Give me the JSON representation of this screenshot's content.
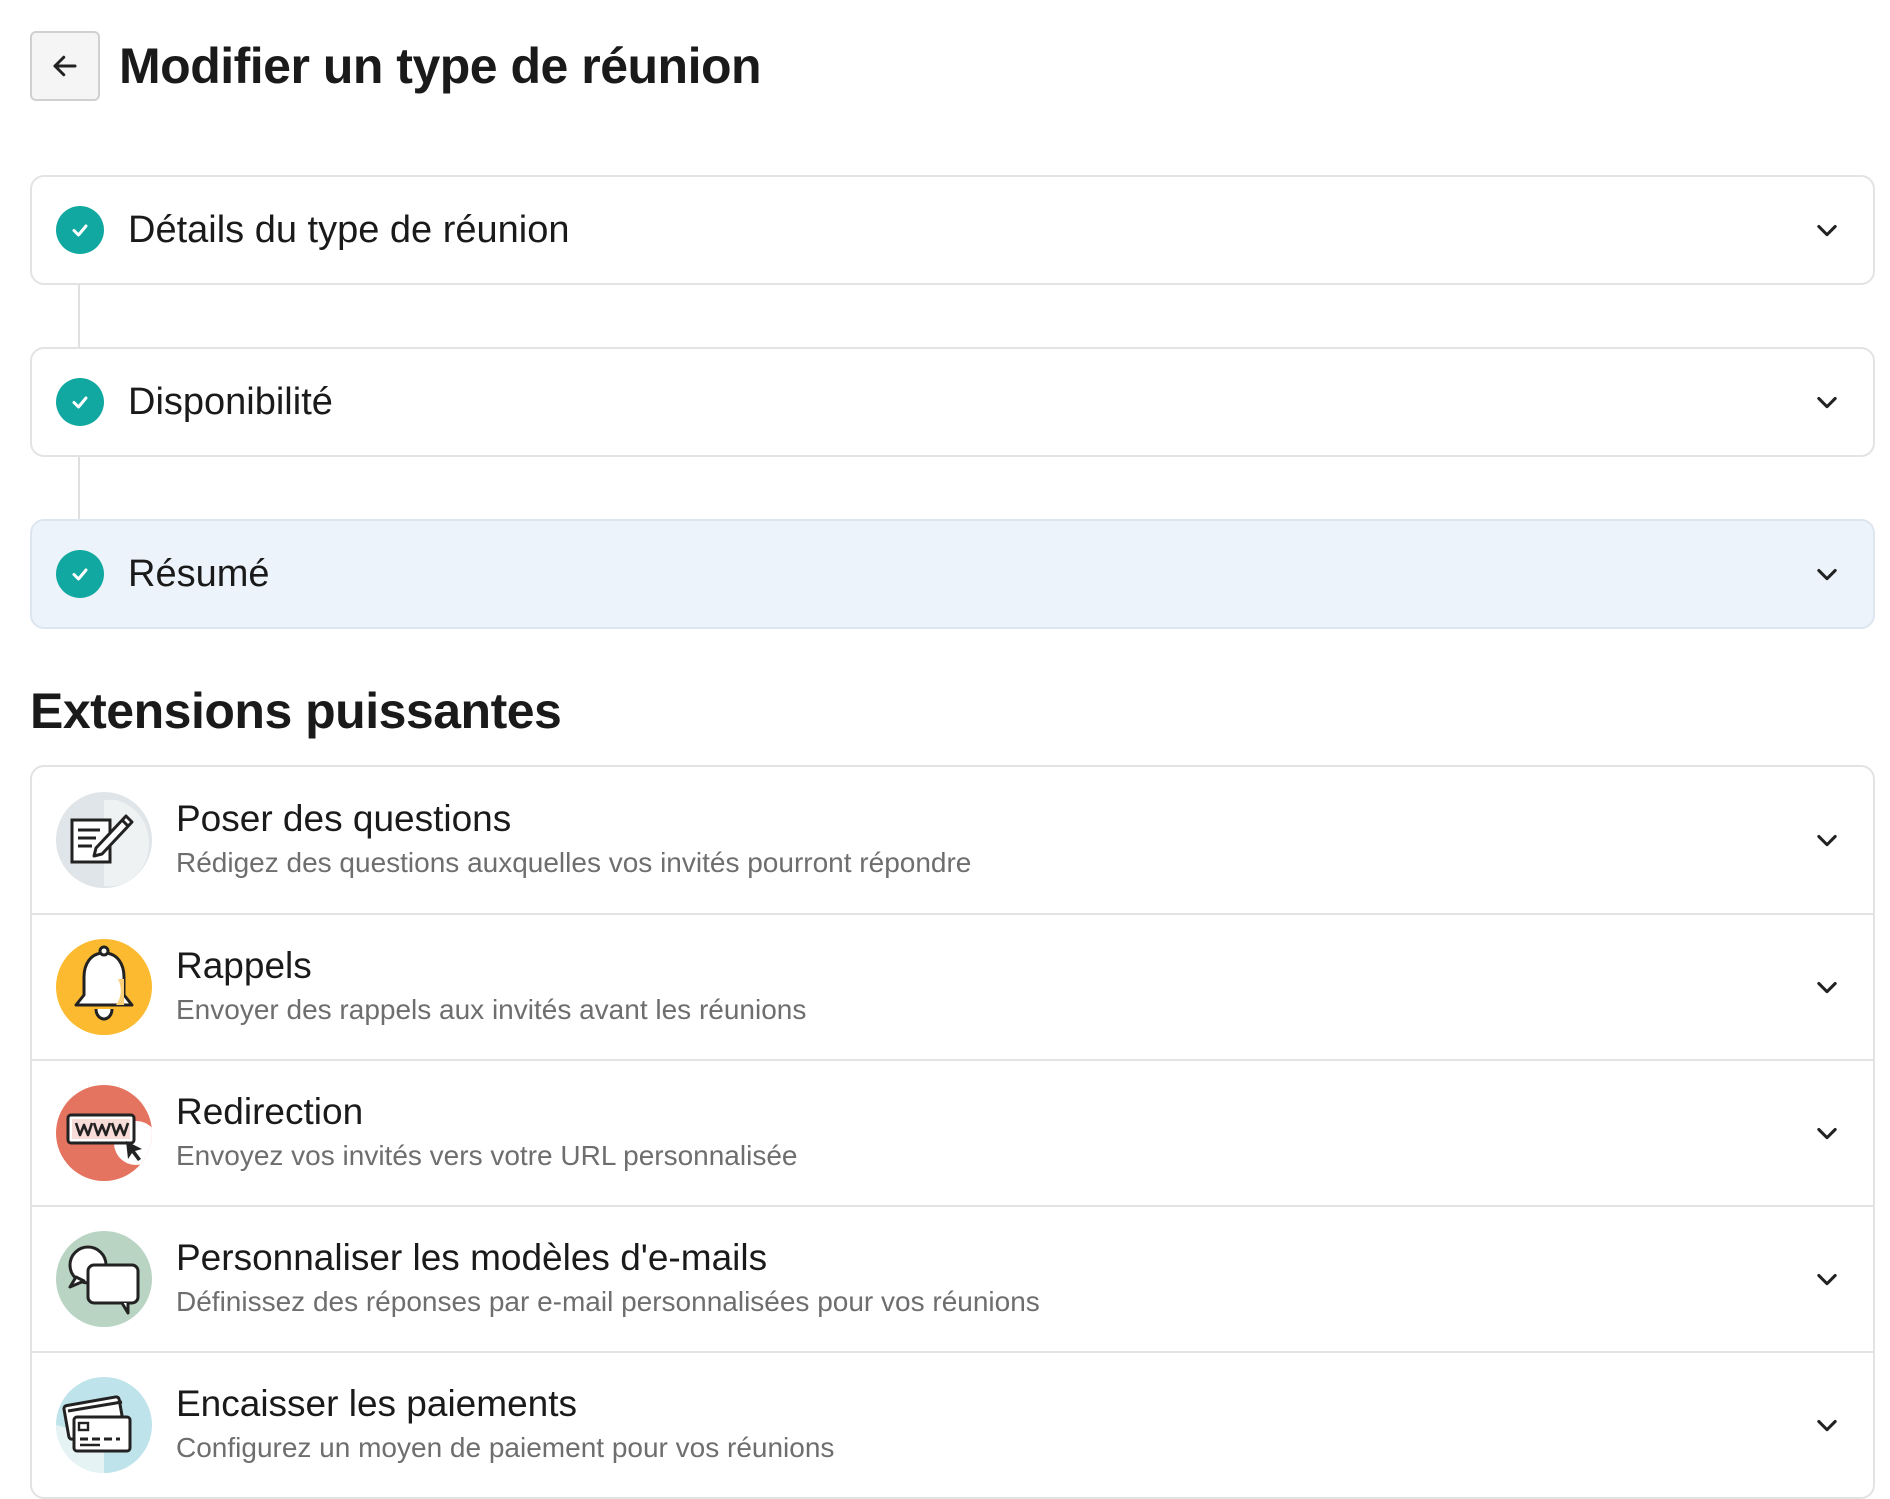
{
  "header": {
    "title": "Modifier un type de réunion"
  },
  "steps": [
    {
      "label": "Détails du type de réunion"
    },
    {
      "label": "Disponibilité"
    },
    {
      "label": "Résumé"
    }
  ],
  "extensions": {
    "title": "Extensions puissantes",
    "items": [
      {
        "title": "Poser des questions",
        "description": "Rédigez des questions auxquelles vos invités pourront répondre",
        "icon": "questions-form-icon",
        "color": "#dfe5e8"
      },
      {
        "title": "Rappels",
        "description": "Envoyer des rappels aux invités avant les réunions",
        "icon": "bell-icon",
        "color": "#fbba2f"
      },
      {
        "title": "Redirection",
        "description": "Envoyez vos invités vers votre URL personnalisée",
        "icon": "www-redirect-icon",
        "color": "#e4735f"
      },
      {
        "title": "Personnaliser les modèles d'e-mails",
        "description": "Définissez des réponses par e-mail personnalisées pour vos réunions",
        "icon": "chat-bubbles-icon",
        "color": "#b9d4c3"
      },
      {
        "title": "Encaisser les paiements",
        "description": "Configurez un moyen de paiement pour vos réunions",
        "icon": "credit-cards-icon",
        "color": "#bfe3ea"
      }
    ]
  },
  "colors": {
    "check": "#10a8a0",
    "active_step_bg": "#edf3fa"
  }
}
